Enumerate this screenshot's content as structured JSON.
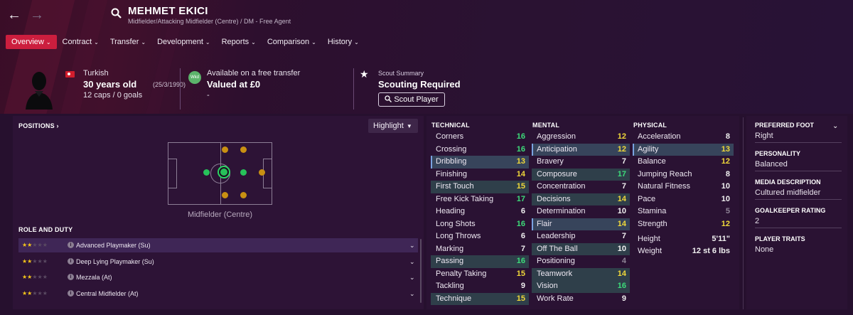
{
  "header": {
    "name": "MEHMET EKICI",
    "subtitle": "Midfielder/Attacking Midfielder (Centre) / DM - Free Agent"
  },
  "tabs": [
    {
      "label": "Overview",
      "active": true
    },
    {
      "label": "Contract"
    },
    {
      "label": "Transfer"
    },
    {
      "label": "Development"
    },
    {
      "label": "Reports"
    },
    {
      "label": "Comparison"
    },
    {
      "label": "History"
    }
  ],
  "info": {
    "nationality": "Turkish",
    "age": "30 years old",
    "dob": "(25/3/1990)",
    "caps": "12 caps / 0 goals",
    "transfer_status": "Available on a free transfer",
    "wages_badge": "Wkd",
    "value": "Valued at £0",
    "value_sub": "-",
    "scout_title": "Scout Summary",
    "scout_status": "Scouting Required",
    "scout_button": "Scout Player"
  },
  "positions": {
    "heading": "POSITIONS",
    "arrow": "›",
    "highlight": "Highlight",
    "position_label": "Midfielder (Centre)"
  },
  "roles": {
    "heading": "ROLE AND DUTY",
    "items": [
      {
        "name": "Advanced Playmaker (Su)",
        "stars": 2
      },
      {
        "name": "Deep Lying Playmaker (Su)",
        "stars": 2
      },
      {
        "name": "Mezzala (At)",
        "stars": 2
      },
      {
        "name": "Central Midfielder (At)",
        "stars": 1.5
      }
    ]
  },
  "technical": {
    "heading": "TECHNICAL",
    "items": [
      {
        "name": "Corners",
        "value": "16"
      },
      {
        "name": "Crossing",
        "value": "16"
      },
      {
        "name": "Dribbling",
        "value": "13"
      },
      {
        "name": "Finishing",
        "value": "14"
      },
      {
        "name": "First Touch",
        "value": "15"
      },
      {
        "name": "Free Kick Taking",
        "value": "17"
      },
      {
        "name": "Heading",
        "value": "6"
      },
      {
        "name": "Long Shots",
        "value": "16"
      },
      {
        "name": "Long Throws",
        "value": "6"
      },
      {
        "name": "Marking",
        "value": "7"
      },
      {
        "name": "Passing",
        "value": "16"
      },
      {
        "name": "Penalty Taking",
        "value": "15"
      },
      {
        "name": "Tackling",
        "value": "9"
      },
      {
        "name": "Technique",
        "value": "15"
      }
    ]
  },
  "mental": {
    "heading": "MENTAL",
    "items": [
      {
        "name": "Aggression",
        "value": "12"
      },
      {
        "name": "Anticipation",
        "value": "12"
      },
      {
        "name": "Bravery",
        "value": "7"
      },
      {
        "name": "Composure",
        "value": "17"
      },
      {
        "name": "Concentration",
        "value": "7"
      },
      {
        "name": "Decisions",
        "value": "14"
      },
      {
        "name": "Determination",
        "value": "10"
      },
      {
        "name": "Flair",
        "value": "14"
      },
      {
        "name": "Leadership",
        "value": "7"
      },
      {
        "name": "Off The Ball",
        "value": "10"
      },
      {
        "name": "Positioning",
        "value": "4"
      },
      {
        "name": "Teamwork",
        "value": "14"
      },
      {
        "name": "Vision",
        "value": "16"
      },
      {
        "name": "Work Rate",
        "value": "9"
      }
    ]
  },
  "physical": {
    "heading": "PHYSICAL",
    "items": [
      {
        "name": "Acceleration",
        "value": "8"
      },
      {
        "name": "Agility",
        "value": "13"
      },
      {
        "name": "Balance",
        "value": "12"
      },
      {
        "name": "Jumping Reach",
        "value": "8"
      },
      {
        "name": "Natural Fitness",
        "value": "10"
      },
      {
        "name": "Pace",
        "value": "10"
      },
      {
        "name": "Stamina",
        "value": "5"
      },
      {
        "name": "Strength",
        "value": "12"
      }
    ],
    "height_label": "Height",
    "height": "5'11\"",
    "weight_label": "Weight",
    "weight": "12 st 6 lbs"
  },
  "side": {
    "foot_h": "PREFERRED FOOT",
    "foot": "Right",
    "personality_h": "PERSONALITY",
    "personality": "Balanced",
    "media_h": "MEDIA DESCRIPTION",
    "media": "Cultured midfielder",
    "gk_h": "GOALKEEPER RATING",
    "gk": "2",
    "traits_h": "PLAYER TRAITS",
    "traits": "None"
  },
  "colors": {
    "accent": "#cc1e3e",
    "green": "#3ddc7a",
    "yellow": "#f0d83a",
    "orange": "#c99012"
  }
}
